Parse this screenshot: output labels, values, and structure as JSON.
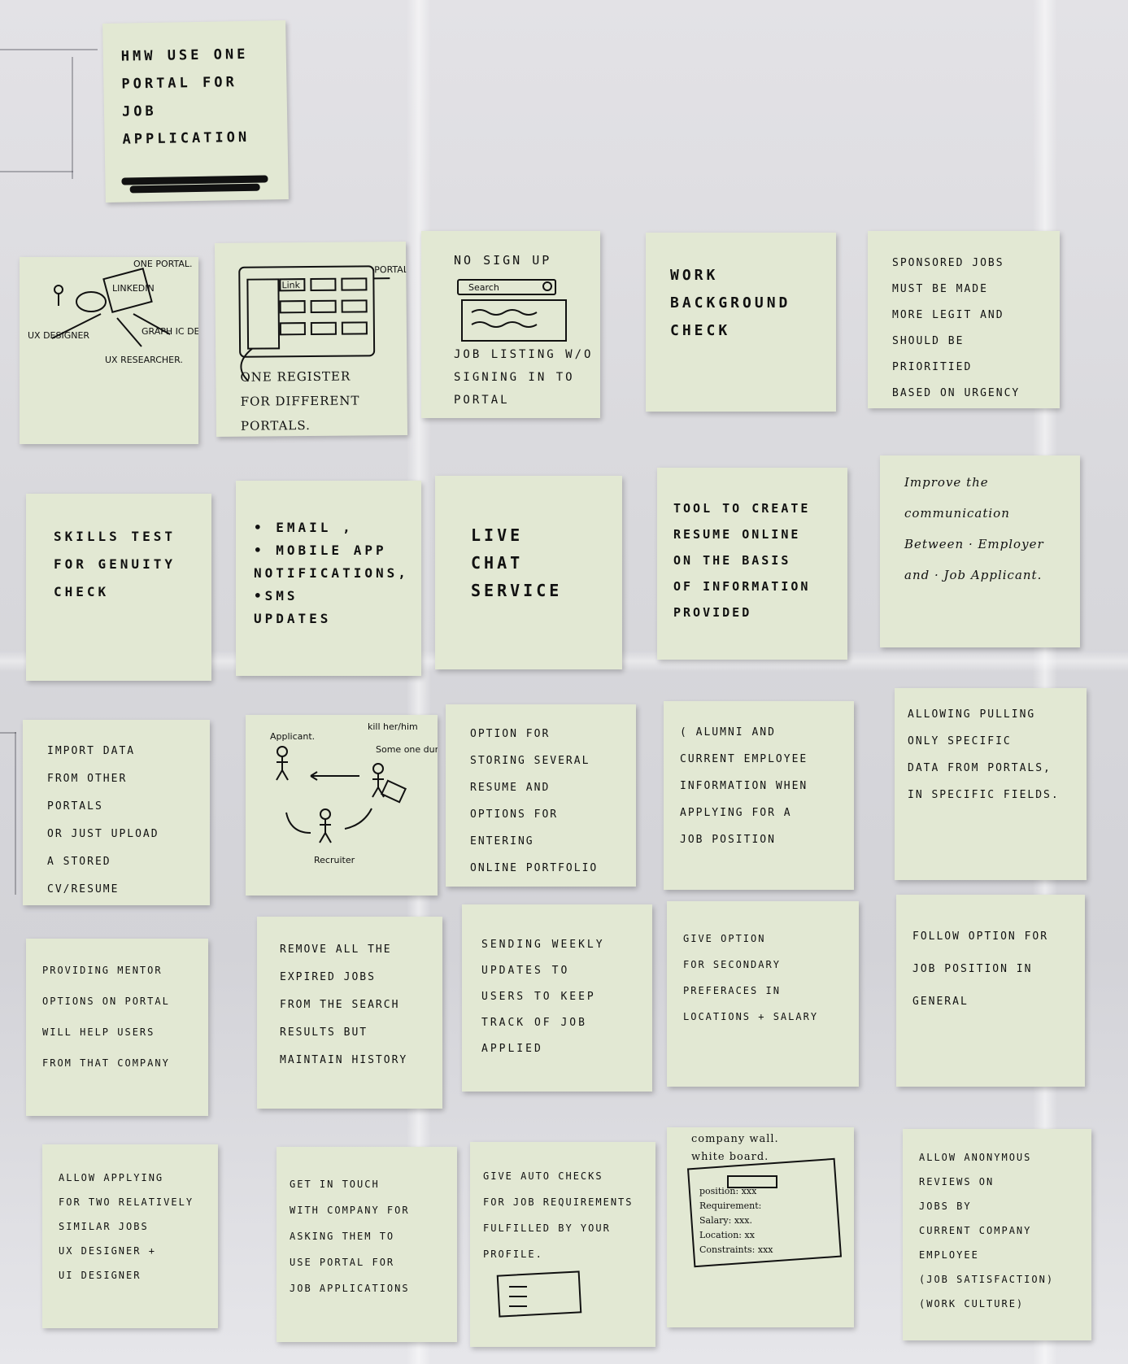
{
  "header_note": "HMW USE ONE\nPORTAL FOR\nJOB APPLICATION",
  "row1": {
    "note1": {
      "one_portal": "ONE PORTAL.",
      "linkedin": "LINKEDIN",
      "ux_designer": "UX DESIGNER",
      "ux_researcher": "UX RESEARCHER.",
      "graphic": "GRAPH IC DESIGNER"
    },
    "note2": {
      "portals": "PORTALS.",
      "link": "Link",
      "caption": "ONE REGISTER\nFOR DIFFERENT PORTALS."
    },
    "note3": {
      "top": "NO SIGN UP",
      "search": "Search",
      "bottom": "JOB LISTING W/O\nSIGNING IN TO\nPORTAL"
    },
    "note4": "WORK\nBACKGROUND\nCHECK",
    "note5": "SPONSORED JOBS\nMUST BE MADE\nMORE LEGIT AND\nSHOULD BE PRIORITIED\nBASED ON URGENCY"
  },
  "row2": {
    "note1": "SKILLS TEST\nFOR GENUITY\nCHECK",
    "note2": "• EMAIL ,\n• MOBILE APP\nNOTIFICATIONS,\n•SMS\nUPDATES",
    "note3": "LIVE\nCHAT\nSERVICE",
    "note4": "TOOL TO CREATE\nRESUME ONLINE\nON THE BASIS\nOF INFORMATION\nPROVIDED",
    "note5": "Improve the communication\nBetween · Employer\nand · Job Applicant."
  },
  "row3": {
    "note1": "IMPORT DATA\nFROM OTHER PORTALS\nOR JUST UPLOAD\nA STORED CV/RESUME",
    "note2": {
      "applicant": "Applicant.",
      "kill": "kill her/him",
      "someone": "Some one\nduring",
      "recruiter": "Recruiter"
    },
    "note3": "OPTION FOR\nSTORING SEVERAL\nRESUME AND\nOPTIONS FOR ENTERING\nONLINE PORTFOLIO",
    "note4": "( ALUMNI AND\nCURRENT EMPLOYEE\nINFORMATION WHEN\nAPPLYING FOR A\nJOB POSITION",
    "note5": "ALLOWING PULLING\nONLY SPECIFIC\nDATA FROM PORTALS,\nIN SPECIFIC FIELDS."
  },
  "row4": {
    "note1": "PROVIDING MENTOR\nOPTIONS ON PORTAL\nWILL HELP USERS\nFROM THAT COMPANY",
    "note2": "REMOVE ALL THE\nEXPIRED JOBS\nFROM THE SEARCH\nRESULTS BUT\nMAINTAIN HISTORY",
    "note3": "SENDING WEEKLY\nUPDATES TO\nUSERS TO KEEP\nTRACK OF JOB\nAPPLIED",
    "note4": "GIVE OPTION\nFOR SECONDARY\nPREFERACES IN\nLOCATIONS + SALARY",
    "note5": "FOLLOW OPTION FOR\nJOB POSITION IN\nGENERAL"
  },
  "row5": {
    "note1": "ALLOW APPLYING\nFOR TWO RELATIVELY\nSIMILAR JOBS\nUX DESIGNER +\nUI DESIGNER",
    "note2": "GET IN TOUCH\nWITH COMPANY FOR\nASKING THEM TO\nUSE PORTAL FOR\nJOB APPLICATIONS",
    "note3": "GIVE AUTO CHECKS\nFOR JOB REQUIREMENTS\nFULFILLED BY YOUR\nPROFILE.",
    "note4": {
      "title": "company wall.\nwhite board.",
      "position": "position: xxx",
      "requirement": "Requirement:",
      "salary": "Salary: xxx.",
      "location": "Location: xx",
      "constraints": "Constraints: xxx"
    },
    "note5": "ALLOW ANONYMOUS\nREVIEWS ON\nJOBS BY\nCURRENT COMPANY\nEMPLOYEE\n(JOB SATISFACTION)\n(WORK CULTURE)"
  }
}
